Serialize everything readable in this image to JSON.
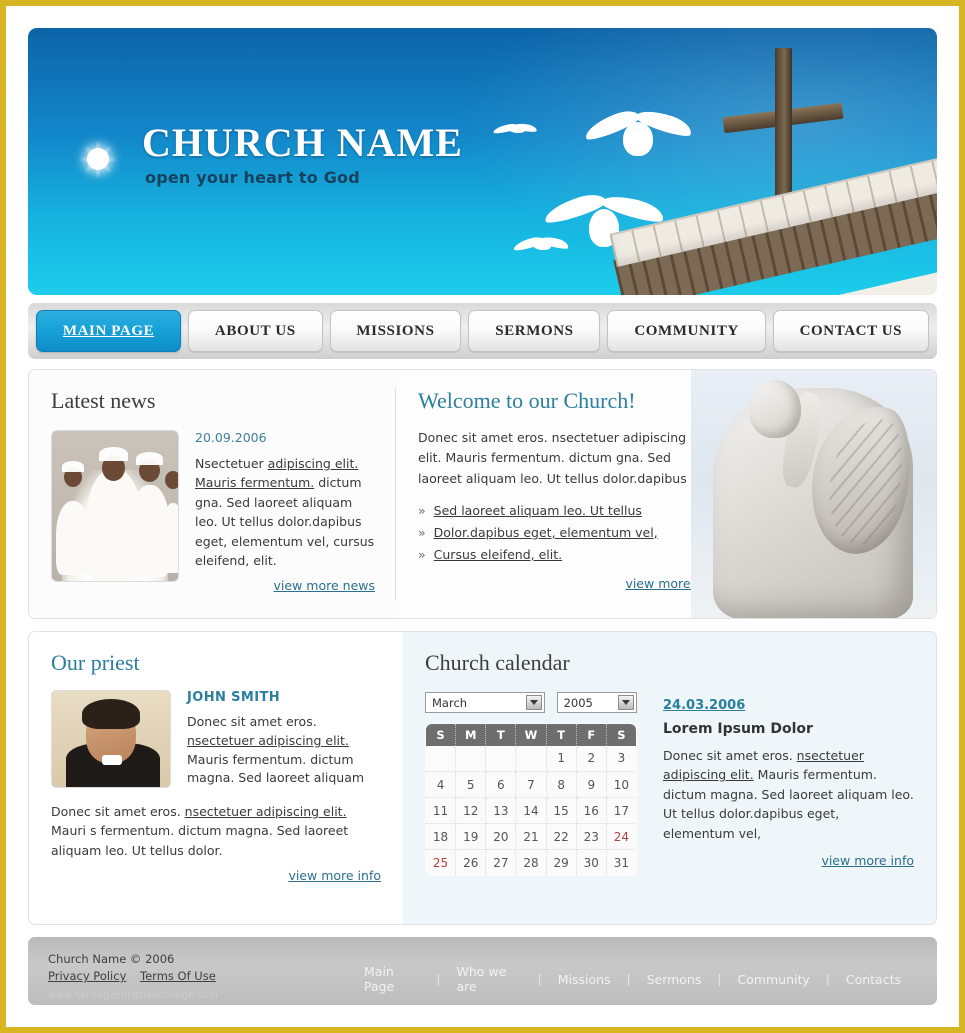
{
  "banner": {
    "brand_title": "CHURCH NAME",
    "tagline": "open your heart to God",
    "logo_icon": "sunburst-icon",
    "imagery": [
      "dove-icon",
      "dove-icon",
      "dove-icon",
      "dove-icon",
      "church-roof",
      "wooden-cross"
    ]
  },
  "nav": {
    "items": [
      {
        "label": "MAIN PAGE",
        "active": true
      },
      {
        "label": "ABOUT US",
        "active": false
      },
      {
        "label": "MISSIONS",
        "active": false
      },
      {
        "label": "SERMONS",
        "active": false
      },
      {
        "label": "COMMUNITY",
        "active": false
      },
      {
        "label": "CONTACT US",
        "active": false
      }
    ]
  },
  "news": {
    "heading": "Latest news",
    "date": "20.09.2006",
    "body_lead": "Nsectetuer ",
    "body_link1": "adipiscing elit. Mauris fermentum.",
    "body_rest": " dictum gna. Sed laoreet aliquam leo. Ut tellus dolor.dapibus eget, elementum vel, cursus eleifend, elit.",
    "more_label": "view more news"
  },
  "welcome": {
    "heading": "Welcome to our Church!",
    "paragraph": "Donec sit amet eros. nsectetuer adipiscing elit. Mauris fermentum. dictum gna. Sed laoreet aliquam leo. Ut tellus dolor.dapibus",
    "bullet_glyph": "»",
    "links": [
      "Sed laoreet aliquam leo. Ut tellus",
      "Dolor.dapibus eget, elementum vel,",
      "Cursus eleifend, elit."
    ],
    "more_label": "view more info",
    "image": "angel-statue"
  },
  "priest": {
    "heading": "Our priest",
    "name": "JOHN SMITH",
    "bio_lead": "Donec sit amet eros. ",
    "bio_link": "nsectetuer adipiscing elit.",
    "bio_rest": " Mauris fermentum. dictum magna. Sed laoreet aliquam",
    "below_lead": "Donec sit amet eros. ",
    "below_link": "nsectetuer adipiscing elit.",
    "below_rest": " Mauri s fermentum. dictum magna. Sed laoreet aliquam leo. Ut tellus dolor.",
    "more_label": "view more info",
    "photo": "priest-portrait"
  },
  "calendar": {
    "heading": "Church calendar",
    "month_value": "March",
    "year_value": "2005",
    "weekdays": [
      "S",
      "M",
      "T",
      "W",
      "T",
      "F",
      "S"
    ],
    "weeks": [
      [
        "",
        "",
        "",
        "",
        "1",
        "2",
        "3"
      ],
      [
        "4",
        "5",
        "6",
        "7",
        "8",
        "9",
        "10"
      ],
      [
        "11",
        "12",
        "13",
        "14",
        "15",
        "16",
        "17"
      ],
      [
        "18",
        "19",
        "20",
        "21",
        "22",
        "23",
        "24"
      ],
      [
        "25",
        "26",
        "27",
        "28",
        "29",
        "30",
        "31"
      ]
    ],
    "highlighted_days": [
      "24",
      "25"
    ],
    "highlight_color": "#b2443c",
    "event": {
      "date": "24.03.2006",
      "title": "Lorem Ipsum Dolor",
      "text_lead": "Donec sit amet eros. ",
      "text_link": "nsectetuer adipiscing elit.",
      "text_rest": " Mauris fermentum. dictum magna. Sed laoreet aliquam leo. Ut tellus dolor.dapibus eget, elementum vel,",
      "more_label": "view more info"
    }
  },
  "footer": {
    "copyright": "Church Name © 2006",
    "privacy_label": "Privacy Policy",
    "terms_label": "Terms Of Use",
    "watermark": "www.heritagechristiancollege.com",
    "links": [
      "Main Page",
      "Who we are",
      "Missions",
      "Sermons",
      "Community",
      "Contacts"
    ],
    "separator": "|"
  },
  "theme": {
    "outer_border": "#d8b623",
    "banner_top": "#0d64a8",
    "banner_bottom": "#1ccdea",
    "accent_teal": "#2a7f9e",
    "active_tab": "#18a3da",
    "footer_bg": "#c0c0c0"
  }
}
